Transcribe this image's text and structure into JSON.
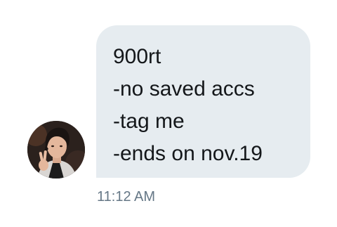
{
  "message": {
    "lines": [
      "900rt",
      "-no saved accs",
      "-tag me",
      "-ends on nov.19"
    ],
    "timestamp": "11:12 AM"
  },
  "colors": {
    "bubble_background": "#e6ecf0",
    "message_text": "#14171a",
    "timestamp_text": "#657786"
  },
  "icons": {
    "avatar": "profile-photo"
  }
}
